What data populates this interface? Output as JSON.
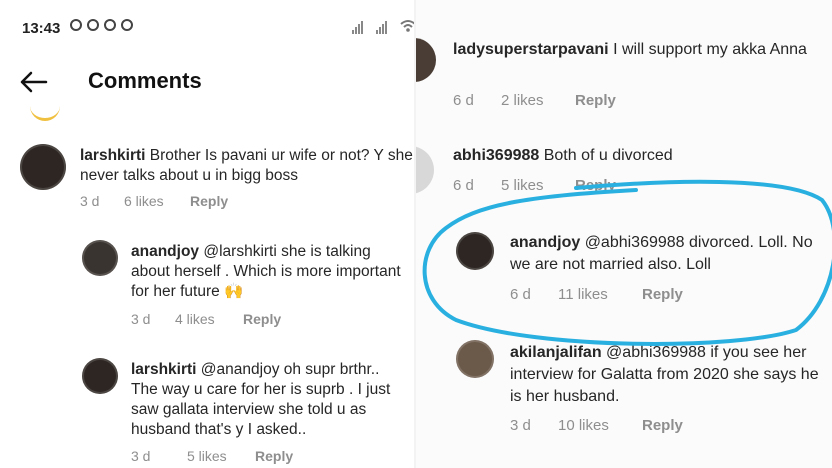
{
  "status": {
    "time": "13:43"
  },
  "header": {
    "title": "Comments"
  },
  "left_comments": [
    {
      "user": "larshkirti",
      "text": "Brother Is pavani ur wife or  not? Y she never talks about u in bigg boss",
      "age": "3 d",
      "likes": "6 likes",
      "reply": "Reply"
    },
    {
      "user": "anandjoy",
      "text": "@larshkirti she is talking about herself . Which is more important for her future 🙌",
      "age": "3 d",
      "likes": "4 likes",
      "reply": "Reply"
    },
    {
      "user": "larshkirti",
      "text": "@anandjoy oh supr brthr.. The way u care for her is  suprb . I just saw gallata interview she told u as husband that's y I asked..",
      "age": "3 d",
      "likes": "5 likes",
      "reply": "Reply"
    }
  ],
  "right_comments": [
    {
      "user": "ladysuperstarpavani",
      "text": "I will  support my akka Anna",
      "age": "6 d",
      "likes": "2 likes",
      "reply": "Reply"
    },
    {
      "user": "abhi369988",
      "text": "Both of u divorced",
      "age": "6 d",
      "likes": "5 likes",
      "reply": "Reply"
    },
    {
      "user": "anandjoy",
      "text": "@abhi369988 divorced. Loll. No we are not married also. Loll",
      "age": "6 d",
      "likes": "11 likes",
      "reply": "Reply"
    },
    {
      "user": "akilanjalifan",
      "text": "@abhi369988 if you see her interview for Galatta from 2020 she says he is her husband.",
      "age": "3 d",
      "likes": "10 likes",
      "reply": "Reply"
    }
  ],
  "colors": {
    "highlight": "#2ab0e0",
    "meta": "#8e8e8e",
    "text": "#262626"
  },
  "icons": [
    "back-arrow-icon",
    "alarm-icon",
    "sync-icon",
    "signal-icon",
    "wifi-icon"
  ]
}
